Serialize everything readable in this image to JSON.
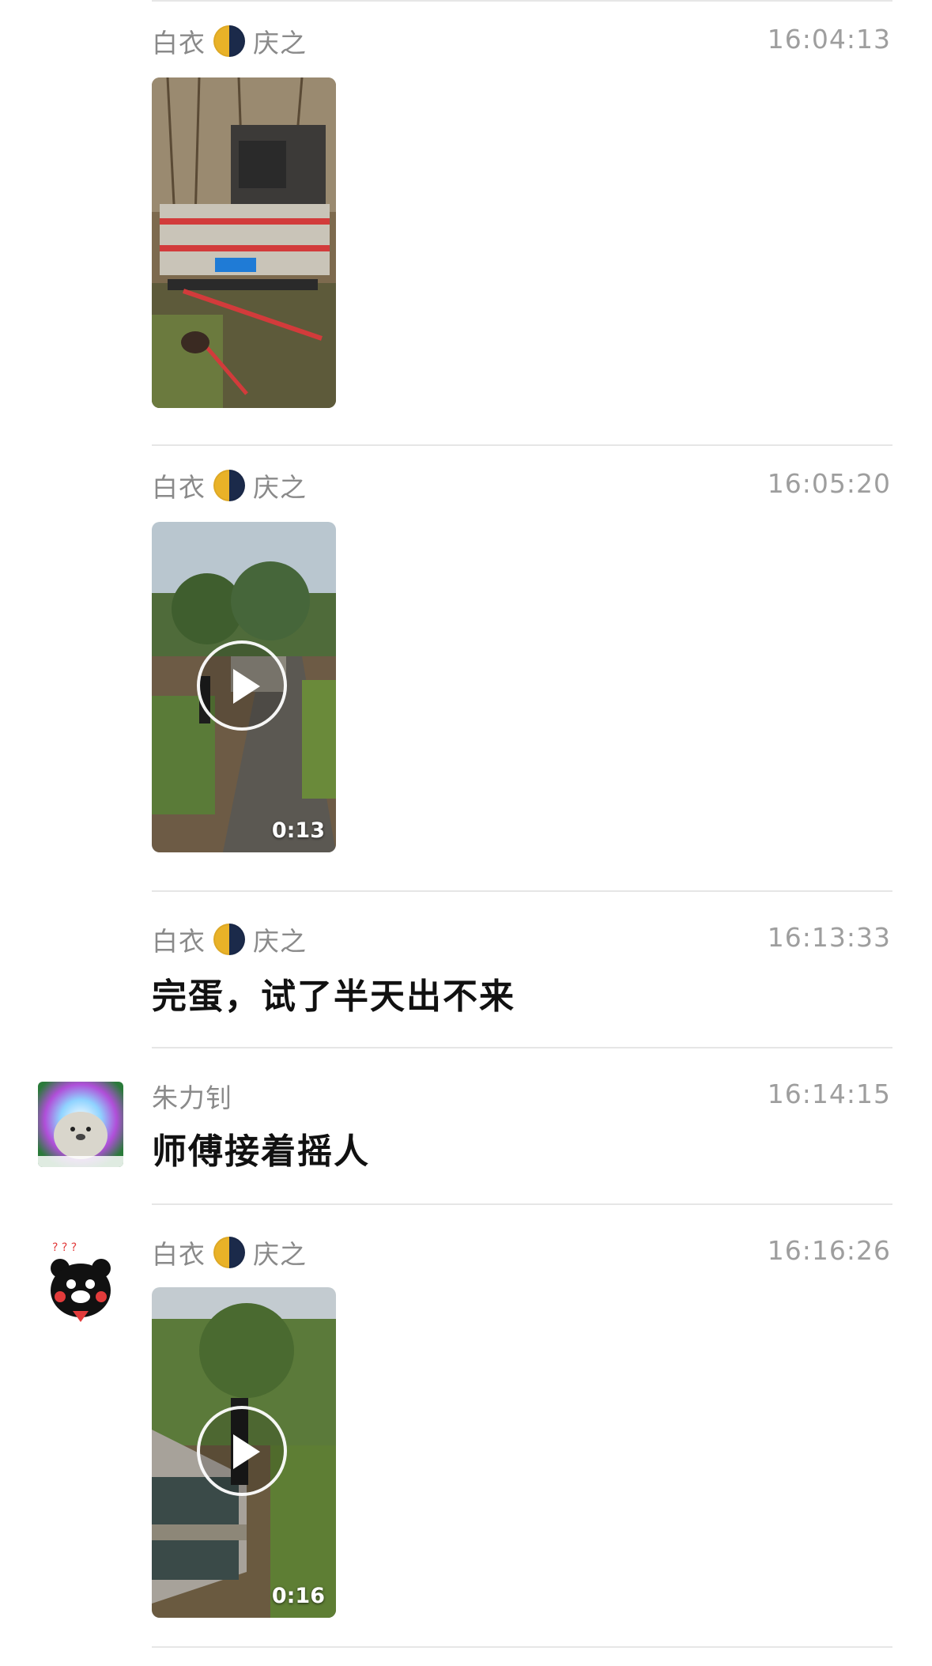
{
  "messages": [
    {
      "sender": "白衣",
      "sender_suffix": "庆之",
      "time": "16:04:13",
      "type": "image"
    },
    {
      "sender": "白衣",
      "sender_suffix": "庆之",
      "time": "16:05:20",
      "type": "video",
      "duration": "0:13"
    },
    {
      "sender": "白衣",
      "sender_suffix": "庆之",
      "time": "16:13:33",
      "type": "text",
      "text": "完蛋，试了半天出不来"
    },
    {
      "sender": "朱力钊",
      "time": "16:14:15",
      "type": "text",
      "text": "师傅接着摇人",
      "avatar_icon": "seal-meme-avatar-icon"
    },
    {
      "sender": "白衣",
      "sender_suffix": "庆之",
      "time": "16:16:26",
      "type": "video",
      "duration": "0:16",
      "avatar_icon": "kumamon-avatar-icon"
    }
  ],
  "colors": {
    "name": "#8a8a8a",
    "time": "#9e9e9e",
    "text": "#111111",
    "divider": "#e6e6e6",
    "moon_light": "#e9b228",
    "moon_dark": "#1b2a4a"
  },
  "icons": {
    "moon": "half-moon-emoji-icon",
    "play": "play-icon"
  }
}
